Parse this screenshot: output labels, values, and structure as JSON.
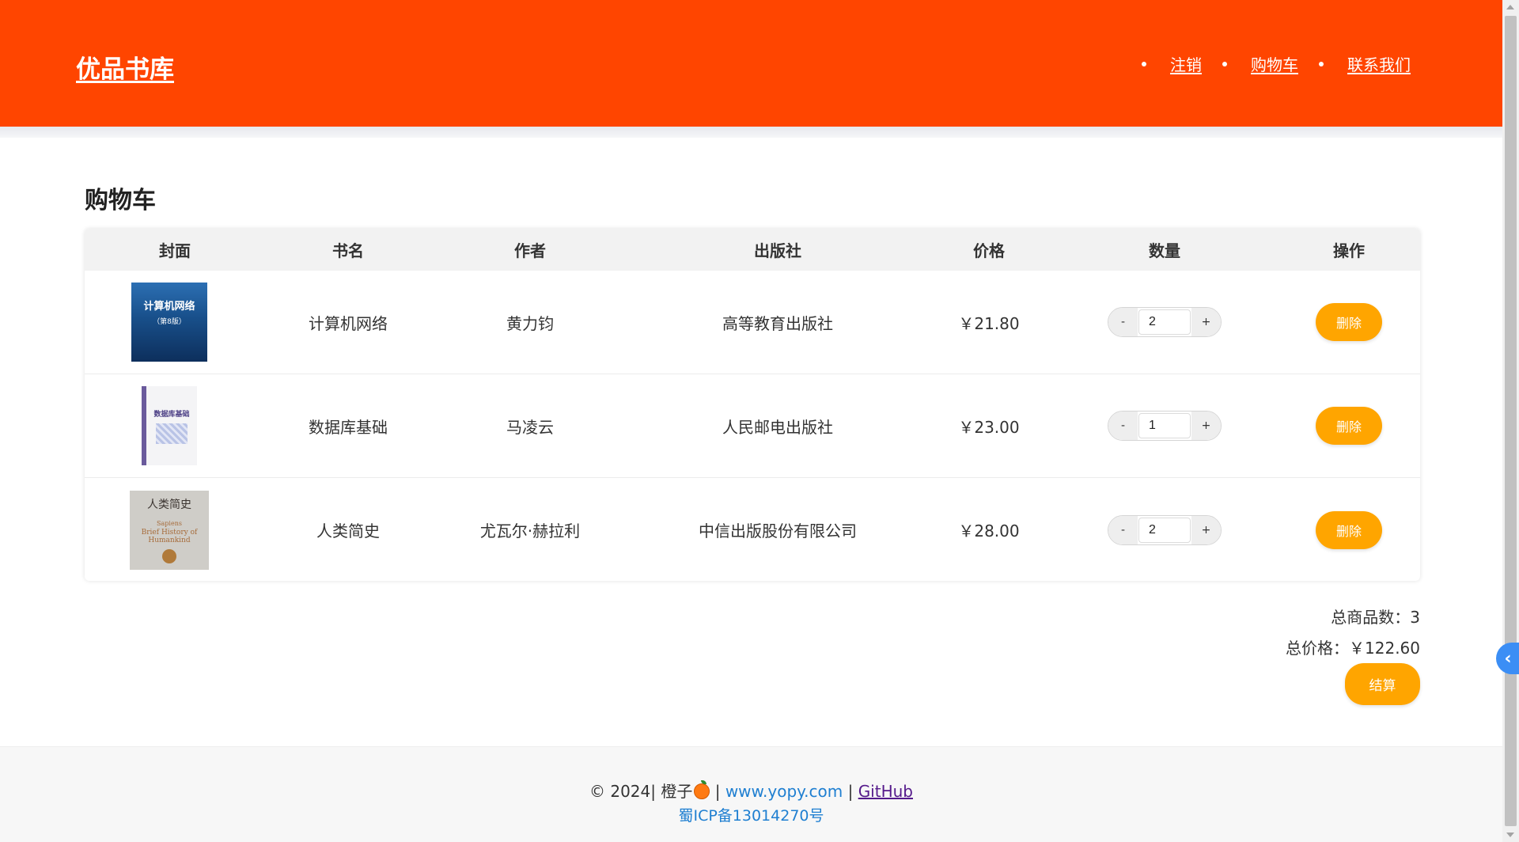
{
  "header": {
    "logo": "优品书库",
    "nav": [
      {
        "label": "注销"
      },
      {
        "label": "购物车"
      },
      {
        "label": "联系我们"
      }
    ],
    "color": "#ff4500"
  },
  "main": {
    "title": "购物车",
    "columns": [
      "封面",
      "书名",
      "作者",
      "出版社",
      "价格",
      "数量",
      "操作"
    ],
    "rows": [
      {
        "cover_title": "计算机网络",
        "cover_sub": "（第8版）",
        "name": "计算机网络",
        "author": "黄力钧",
        "publisher": "高等教育出版社",
        "price": "￥21.80",
        "qty": "2",
        "delete": "删除"
      },
      {
        "cover_title": "数据库基础",
        "name": "数据库基础",
        "author": "马凌云",
        "publisher": "人民邮电出版社",
        "price": "￥23.00",
        "qty": "1",
        "delete": "删除"
      },
      {
        "cover_title": "人类简史",
        "cover_sub": "Sapiens",
        "cover_sub2": "Brief History of Humankind",
        "name": "人类简史",
        "author": "尤瓦尔·赫拉利",
        "publisher": "中信出版股份有限公司",
        "price": "￥28.00",
        "qty": "2",
        "delete": "删除"
      }
    ],
    "stepper_minus": "-",
    "stepper_plus": "+",
    "summary_count": "总商品数：3",
    "summary_price": "总价格：￥122.60",
    "checkout": "结算",
    "accent": "#ffa500"
  },
  "footer": {
    "copyright": "© 2024| 橙子",
    "separator1": " | ",
    "site_link": "www.yopy.com",
    "separator2": " | ",
    "github_link": "GitHub",
    "icp": "蜀ICP备13014270号"
  },
  "icons": {
    "footer_icon": "orange-fruit-icon",
    "side_tab_icon": "chevron-left-icon",
    "side_tab_glyph": "‹"
  }
}
